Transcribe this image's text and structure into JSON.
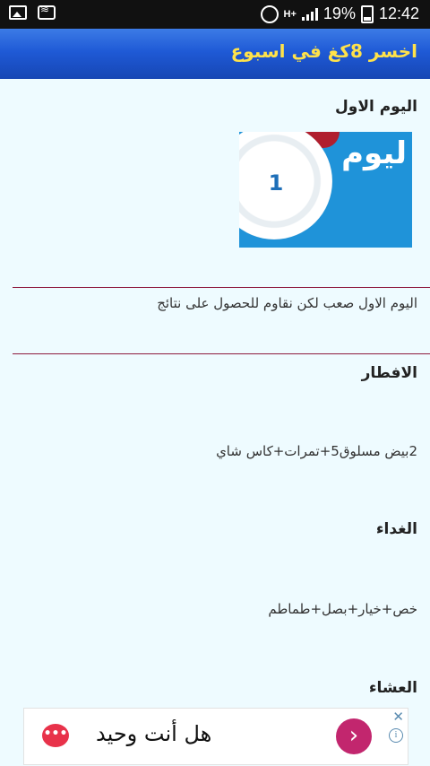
{
  "status_bar": {
    "battery": "19%",
    "time": "12:42",
    "network": "H+"
  },
  "app_bar": {
    "title": "اخسر 8كغ في اسبوع"
  },
  "day": {
    "heading": "اليوم الاول",
    "image_label": "ليوم",
    "image_number": "1",
    "intro": "اليوم الاول صعب لكن نقاوم للحصول على نتائج"
  },
  "meals": [
    {
      "heading": "الافطار",
      "text": "2بيض مسلوق5+تمرات+كاس شاي"
    },
    {
      "heading": "الغداء",
      "text": "خص+خيار+بصل+طماطم"
    },
    {
      "heading": "العشاء",
      "text": ""
    }
  ],
  "ad": {
    "text": "هل أنت وحيد",
    "bubble_icon": "chat-bubble-icon",
    "arrow": "›",
    "close": "✕",
    "info": "i"
  }
}
